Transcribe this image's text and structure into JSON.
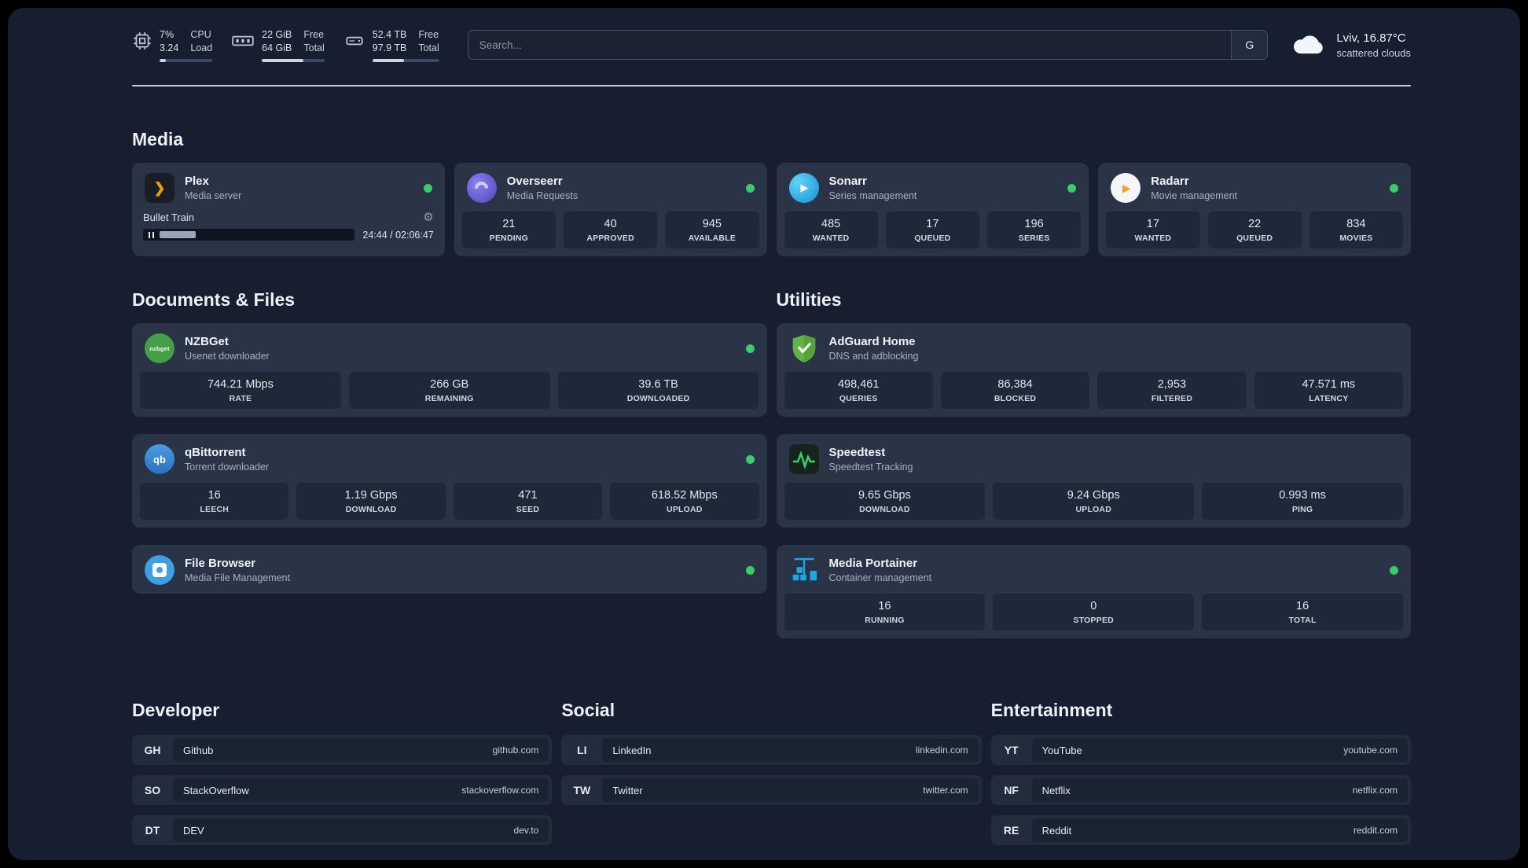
{
  "topbar": {
    "cpu": {
      "value_top": "7%",
      "value_bottom": "3.24",
      "label_top": "CPU",
      "label_bottom": "Load",
      "bar_pct": 12
    },
    "ram": {
      "value_top": "22 GiB",
      "value_bottom": "64 GiB",
      "label_top": "Free",
      "label_bottom": "Total",
      "bar_pct": 66
    },
    "disk": {
      "value_top": "52.4 TB",
      "value_bottom": "97.9 TB",
      "label_top": "Free",
      "label_bottom": "Total",
      "bar_pct": 47
    },
    "search": {
      "placeholder": "Search...",
      "engine_label": "G"
    },
    "weather": {
      "location": "Lviv, 16.87°C",
      "condition": "scattered clouds"
    }
  },
  "sections": {
    "media": "Media",
    "documents": "Documents & Files",
    "utilities": "Utilities",
    "developer": "Developer",
    "social": "Social",
    "entertainment": "Entertainment"
  },
  "apps": {
    "plex": {
      "name": "Plex",
      "subtitle": "Media server",
      "player": {
        "title": "Bullet Train",
        "time": "24:44 / 02:06:47",
        "progress_pct": 17
      }
    },
    "overseerr": {
      "name": "Overseerr",
      "subtitle": "Media Requests",
      "stats": [
        {
          "value": "21",
          "label": "PENDING"
        },
        {
          "value": "40",
          "label": "APPROVED"
        },
        {
          "value": "945",
          "label": "AVAILABLE"
        }
      ]
    },
    "sonarr": {
      "name": "Sonarr",
      "subtitle": "Series management",
      "stats": [
        {
          "value": "485",
          "label": "WANTED"
        },
        {
          "value": "17",
          "label": "QUEUED"
        },
        {
          "value": "196",
          "label": "SERIES"
        }
      ]
    },
    "radarr": {
      "name": "Radarr",
      "subtitle": "Movie management",
      "stats": [
        {
          "value": "17",
          "label": "WANTED"
        },
        {
          "value": "22",
          "label": "QUEUED"
        },
        {
          "value": "834",
          "label": "MOVIES"
        }
      ]
    },
    "nzbget": {
      "name": "NZBGet",
      "subtitle": "Usenet downloader",
      "stats": [
        {
          "value": "744.21 Mbps",
          "label": "RATE"
        },
        {
          "value": "266 GB",
          "label": "REMAINING"
        },
        {
          "value": "39.6 TB",
          "label": "DOWNLOADED"
        }
      ]
    },
    "qbittorrent": {
      "name": "qBittorrent",
      "subtitle": "Torrent downloader",
      "stats": [
        {
          "value": "16",
          "label": "LEECH"
        },
        {
          "value": "1.19 Gbps",
          "label": "DOWNLOAD"
        },
        {
          "value": "471",
          "label": "SEED"
        },
        {
          "value": "618.52 Mbps",
          "label": "UPLOAD"
        }
      ]
    },
    "filebrowser": {
      "name": "File Browser",
      "subtitle": "Media File Management"
    },
    "adguard": {
      "name": "AdGuard Home",
      "subtitle": "DNS and adblocking",
      "stats": [
        {
          "value": "498,461",
          "label": "QUERIES"
        },
        {
          "value": "86,384",
          "label": "BLOCKED"
        },
        {
          "value": "2,953",
          "label": "FILTERED"
        },
        {
          "value": "47.571 ms",
          "label": "LATENCY"
        }
      ]
    },
    "speedtest": {
      "name": "Speedtest",
      "subtitle": "Speedtest Tracking",
      "stats": [
        {
          "value": "9.65 Gbps",
          "label": "DOWNLOAD"
        },
        {
          "value": "9.24 Gbps",
          "label": "UPLOAD"
        },
        {
          "value": "0.993 ms",
          "label": "PING"
        }
      ]
    },
    "portainer": {
      "name": "Media Portainer",
      "subtitle": "Container management",
      "stats": [
        {
          "value": "16",
          "label": "RUNNING"
        },
        {
          "value": "0",
          "label": "STOPPED"
        },
        {
          "value": "16",
          "label": "TOTAL"
        }
      ]
    }
  },
  "bookmarks": {
    "developer": [
      {
        "abbr": "GH",
        "name": "Github",
        "url": "github.com"
      },
      {
        "abbr": "SO",
        "name": "StackOverflow",
        "url": "stackoverflow.com"
      },
      {
        "abbr": "DT",
        "name": "DEV",
        "url": "dev.to"
      }
    ],
    "social": [
      {
        "abbr": "LI",
        "name": "LinkedIn",
        "url": "linkedin.com"
      },
      {
        "abbr": "TW",
        "name": "Twitter",
        "url": "twitter.com"
      }
    ],
    "entertainment": [
      {
        "abbr": "YT",
        "name": "YouTube",
        "url": "youtube.com"
      },
      {
        "abbr": "NF",
        "name": "Netflix",
        "url": "netflix.com"
      },
      {
        "abbr": "RE",
        "name": "Reddit",
        "url": "reddit.com"
      }
    ]
  }
}
